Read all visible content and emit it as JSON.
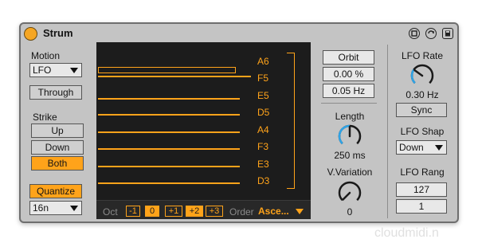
{
  "device": {
    "title": "Strum",
    "icons": [
      "map-icon",
      "hot-swap-icon",
      "save-preset-icon"
    ]
  },
  "left": {
    "motion_label": "Motion",
    "motion_value": "LFO",
    "through_label": "Through",
    "strike_label": "Strike",
    "strike_options": [
      {
        "label": "Up",
        "active": false
      },
      {
        "label": "Down",
        "active": false
      },
      {
        "label": "Both",
        "active": true
      }
    ],
    "quantize_label": "Quantize",
    "quantize_value": "16n"
  },
  "display": {
    "notes": [
      "A6",
      "F5",
      "E5",
      "D5",
      "A4",
      "F3",
      "E3",
      "D3"
    ],
    "oct_label": "Oct",
    "oct_options": [
      {
        "label": "-1",
        "active": false
      },
      {
        "label": "0",
        "active": true
      },
      {
        "label": "+1",
        "active": false
      },
      {
        "label": "+2",
        "active": true
      },
      {
        "label": "+3",
        "active": false
      }
    ],
    "order_label": "Order",
    "order_value": "Asce..."
  },
  "middle": {
    "mode_value": "Orbit",
    "percent_value": "0.00 %",
    "hz_value": "0.05 Hz",
    "length_label": "Length",
    "length_value": "250 ms",
    "length_level": 0.5,
    "vvar_label": "V.Variation",
    "vvar_value": "0",
    "vvar_level": 0.0
  },
  "right": {
    "lfo_rate_label": "LFO Rate",
    "lfo_rate_value": "0.30 Hz",
    "lfo_rate_level": 0.3,
    "sync_label": "Sync",
    "lfo_shape_label": "LFO Shap",
    "lfo_shape_value": "Down",
    "lfo_range_label": "LFO Rang",
    "range_top": "127",
    "range_bottom": "1"
  },
  "colors": {
    "accent": "#ffa31a",
    "panel": "#c4c4c4",
    "display_bg": "#1c1c1c",
    "knob_arc": "#2ea3e6"
  },
  "watermark": "cloudmidi.n"
}
